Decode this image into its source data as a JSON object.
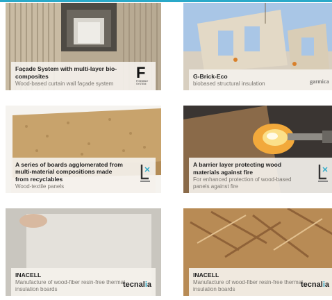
{
  "cards": [
    {
      "title": "Façade System with multi-layer bio-composites",
      "subtitle": "Wood-based curtain wall façade system",
      "logo": "F",
      "logo_small": "FOSSIBLE · SYSTEM"
    },
    {
      "title": "G-Brick-Eco",
      "subtitle": "biobased structural insulation",
      "logo": "garmica"
    },
    {
      "title": "A series of boards agglomerated from multi-material compositions made from recyclables",
      "subtitle": "Wood-textile panels",
      "logo": "tree-logo-icon"
    },
    {
      "title": "A barrier layer protecting wood materials against fire",
      "subtitle": "For enhanced protection of wood-based panels against fire",
      "logo": "tree-logo-icon"
    },
    {
      "title": "INACELL",
      "subtitle": "Manufacture of wood-fiber resin-free thermal insulation boards",
      "logo_a": "tecnal",
      "logo_b": "i",
      "logo_c": "a"
    },
    {
      "title": "INACELL",
      "subtitle": "Manufacture of wood-fiber resin-free thermal insulation boards",
      "logo_a": "tecnal",
      "logo_b": "i",
      "logo_c": "a"
    }
  ],
  "colors": {
    "accent": "#2aa9c9",
    "caption_bg": "#f4f1ec"
  }
}
